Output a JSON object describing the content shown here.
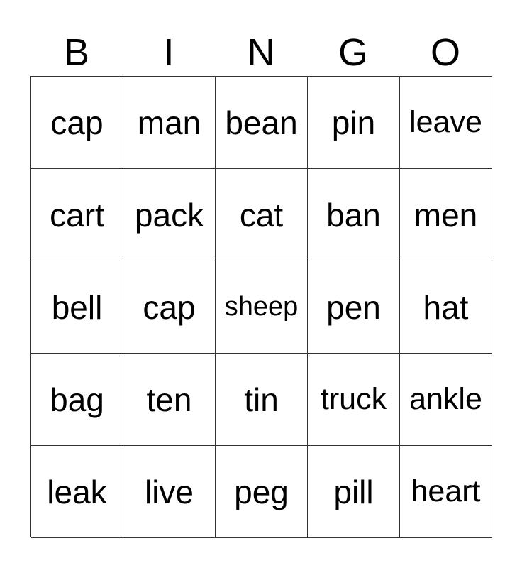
{
  "header": [
    "B",
    "I",
    "N",
    "G",
    "O"
  ],
  "rows": [
    [
      "cap",
      "man",
      "bean",
      "pin",
      "leave"
    ],
    [
      "cart",
      "pack",
      "cat",
      "ban",
      "men"
    ],
    [
      "bell",
      "cap",
      "sheep",
      "pen",
      "hat"
    ],
    [
      "bag",
      "ten",
      "tin",
      "truck",
      "ankle"
    ],
    [
      "leak",
      "live",
      "peg",
      "pill",
      "heart"
    ]
  ]
}
